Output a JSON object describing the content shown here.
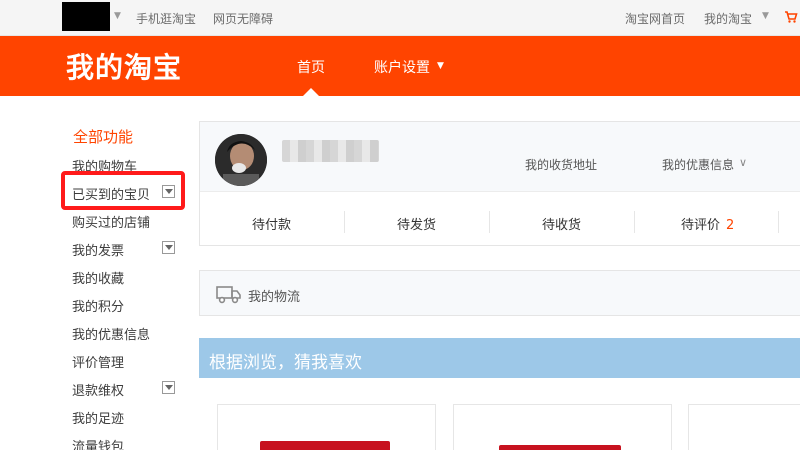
{
  "topbar": {
    "mobile_label": "手机逛淘宝",
    "accessibility_label": "网页无障碍",
    "home_link": "淘宝网首页",
    "my_taobao": "我的淘宝"
  },
  "header": {
    "logo": "我的淘宝",
    "nav_home": "首页",
    "nav_account": "账户设置"
  },
  "sidebar": {
    "title": "全部功能",
    "items": [
      "我的购物车",
      "已买到的宝贝",
      "购买过的店铺",
      "我的发票",
      "我的收藏",
      "我的积分",
      "我的优惠信息",
      "评价管理",
      "退款维权",
      "我的足迹",
      "流量钱包"
    ]
  },
  "profile": {
    "address_link": "我的收货地址",
    "coupon_link": "我的优惠信息"
  },
  "orders": [
    {
      "label": "待付款",
      "count": ""
    },
    {
      "label": "待发货",
      "count": ""
    },
    {
      "label": "待收货",
      "count": ""
    },
    {
      "label": "待评价",
      "count": "2"
    }
  ],
  "logistics": {
    "label": "我的物流"
  },
  "recommend": {
    "title": "根据浏览，猜我喜欢"
  },
  "colors": {
    "brand_orange": "#ff4400",
    "highlight_red": "#ff1a1a",
    "recommend_blue": "#9dc8e8"
  }
}
